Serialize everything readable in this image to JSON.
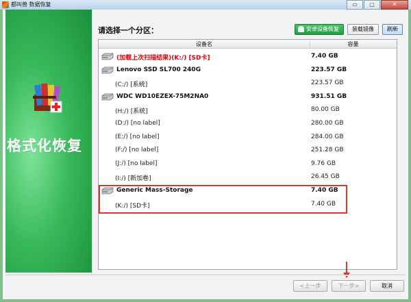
{
  "window": {
    "title": "都叫兽 数据恢复",
    "minimize_label": "▭",
    "restore_label": "▢",
    "close_label": "✕"
  },
  "left_panel": {
    "title": "格式化恢复",
    "icon": "winrar-books-icon"
  },
  "main": {
    "heading": "请选择一个分区：",
    "android_button": "安卓设备恢复",
    "mount_button": "装载镜像",
    "refresh_button": "刷新",
    "columns": {
      "name": "设备名",
      "size": "容量"
    },
    "rows": [
      {
        "type": "disk",
        "red": true,
        "name": "(加载上次扫描结果)(K:/) [SD卡]",
        "size": "7.40 GB"
      },
      {
        "type": "disk",
        "red": false,
        "name": "Lenovo SSD SL700 240G",
        "size": "223.57 GB"
      },
      {
        "type": "part",
        "red": false,
        "name": "(C:/) [系统]",
        "size": "223.57 GB"
      },
      {
        "type": "disk",
        "red": false,
        "name": "WDC WD10EZEX-75M2NA0",
        "size": "931.51 GB"
      },
      {
        "type": "part",
        "red": false,
        "name": "(H:/) [系统]",
        "size": "80.00 GB"
      },
      {
        "type": "part",
        "red": false,
        "name": "(D:/) [no label]",
        "size": "280.00 GB"
      },
      {
        "type": "part",
        "red": false,
        "name": "(E:/) [no label]",
        "size": "284.00 GB"
      },
      {
        "type": "part",
        "red": false,
        "name": "(F:/) [no label]",
        "size": "251.28 GB"
      },
      {
        "type": "part",
        "red": false,
        "name": "(J:/) [no label]",
        "size": "9.76 GB"
      },
      {
        "type": "part",
        "red": false,
        "name": "(I:/) [新加卷]",
        "size": "26.45 GB"
      },
      {
        "type": "disk",
        "red": false,
        "name": "Generic Mass-Storage",
        "size": "7.40 GB"
      },
      {
        "type": "part",
        "red": false,
        "name": "(K:/) [SD卡]",
        "size": "7.40 GB"
      }
    ]
  },
  "footer": {
    "prev_button": "<上一步",
    "next_button": "下一步>",
    "cancel_button": "取消"
  },
  "colors": {
    "accent_green": "#1f9e45",
    "highlight_red": "#e4312b"
  }
}
